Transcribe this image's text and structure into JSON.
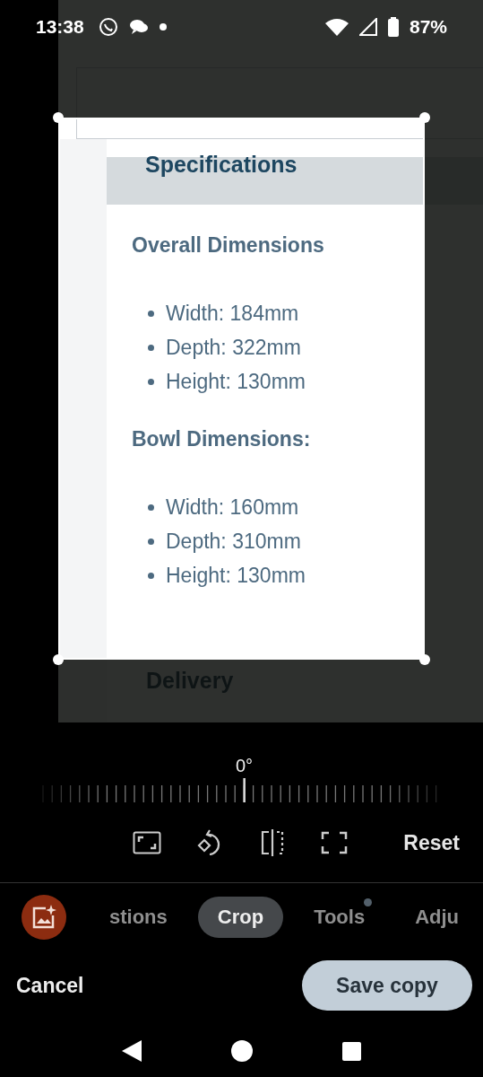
{
  "status_bar": {
    "time": "13:38",
    "battery": "87%"
  },
  "photo": {
    "heading": "Specifications",
    "sections": [
      {
        "title": "Overall Dimensions",
        "items": [
          "Width: 184mm",
          "Depth: 322mm",
          "Height: 130mm"
        ]
      },
      {
        "title": "Bowl Dimensions:",
        "items": [
          "Width: 160mm",
          "Depth: 310mm",
          "Height: 130mm"
        ]
      }
    ],
    "next_heading": "Delivery"
  },
  "rotation": {
    "angle": "0°",
    "level": 0.5
  },
  "tools": {
    "reset": "Reset"
  },
  "tabs": [
    {
      "label": "stions",
      "selected": false,
      "dot": false
    },
    {
      "label": "Crop",
      "selected": true,
      "dot": false
    },
    {
      "label": "Tools",
      "selected": false,
      "dot": true
    },
    {
      "label": "Adju",
      "selected": false,
      "dot": false
    }
  ],
  "actions": {
    "cancel": "Cancel",
    "save": "Save copy"
  }
}
